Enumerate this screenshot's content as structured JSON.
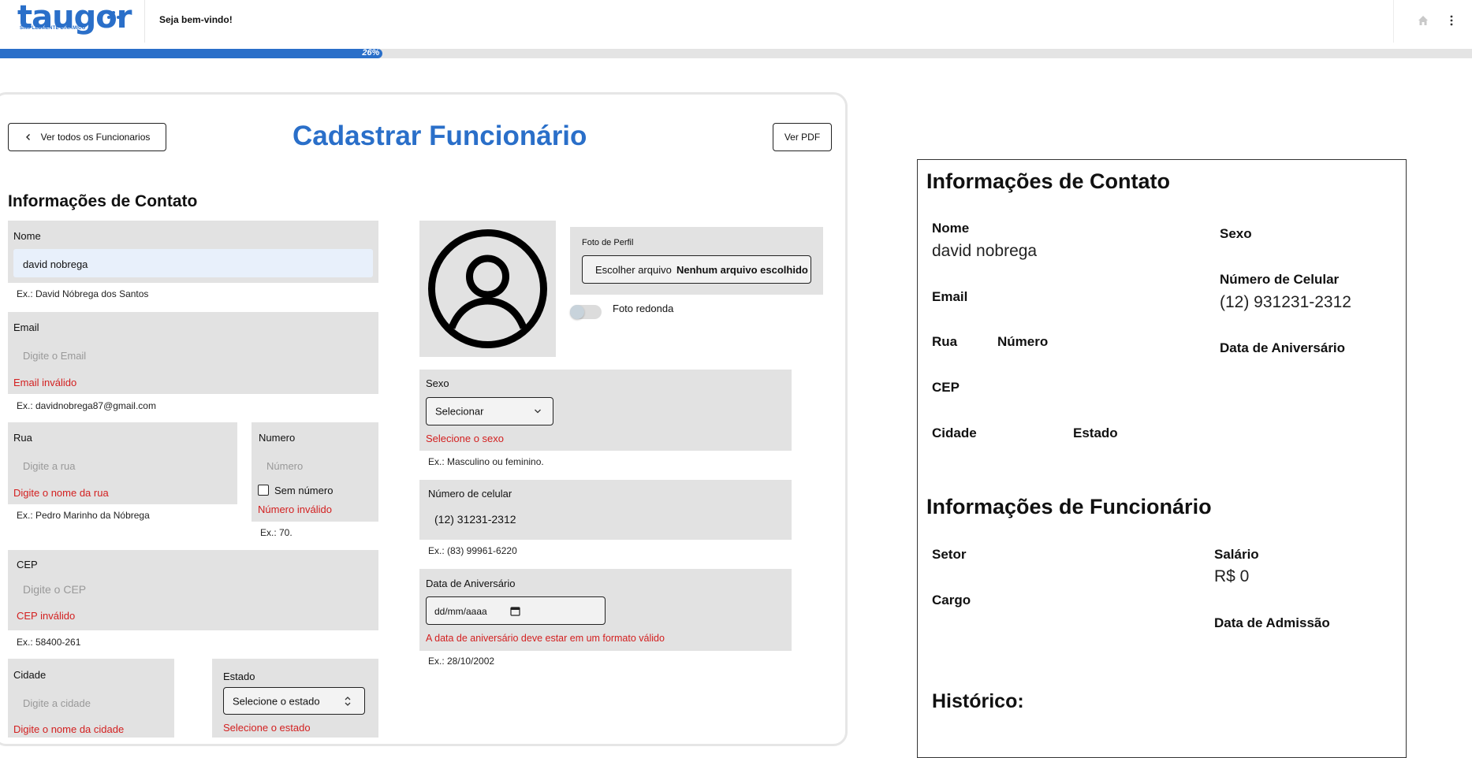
{
  "header": {
    "logo_text": "taugor",
    "logo_tagline": "SIMPLESMENTE DINÂMICO",
    "welcome": "Seja bem-vindo!",
    "home_icon": "home-icon",
    "menu_icon": "kebab-menu-icon"
  },
  "progress": {
    "value_percent": 26,
    "label": "26%"
  },
  "form": {
    "back_button": "Ver todos os Funcionarios",
    "title": "Cadastrar Funcionário",
    "pdf_button": "Ver PDF",
    "section_title": "Informações de Contato",
    "nome": {
      "label": "Nome",
      "value": "david nobrega",
      "hint": "Ex.: David Nóbrega dos Santos"
    },
    "email": {
      "label": "Email",
      "placeholder": "Digite o Email",
      "error": "Email inválido",
      "hint": "Ex.: davidnobrega87@gmail.com"
    },
    "rua": {
      "label": "Rua",
      "placeholder": "Digite a rua",
      "error": "Digite o nome da rua",
      "hint": "Ex.: Pedro Marinho da Nóbrega"
    },
    "numero": {
      "label": "Numero",
      "placeholder": "Número",
      "checkbox_label": "Sem número",
      "error": "Número inválido",
      "hint": "Ex.: 70."
    },
    "cep": {
      "label": "CEP",
      "placeholder": "Digite o CEP",
      "error": "CEP inválido",
      "hint": "Ex.: 58400-261"
    },
    "cidade": {
      "label": "Cidade",
      "placeholder": "Digite a cidade",
      "error": "Digite o nome da cidade"
    },
    "estado": {
      "label": "Estado",
      "selected": "Selecione o estado",
      "error": "Selecione o estado"
    },
    "foto": {
      "label": "Foto de Perfil",
      "button": "Escolher arquivo",
      "status": "Nenhum arquivo escolhido",
      "toggle_label": "Foto redonda",
      "toggle_on": false
    },
    "sexo": {
      "label": "Sexo",
      "selected": "Selecionar",
      "error": "Selecione o sexo",
      "hint": "Ex.: Masculino ou feminino."
    },
    "celular": {
      "label": "Número de celular",
      "value": "(12) 31231-2312",
      "hint": "Ex.: (83) 99961-6220"
    },
    "aniversario": {
      "label": "Data de Aniversário",
      "placeholder": "dd/mm/aaaa",
      "error": "A data de aniversário deve estar em um formato válido",
      "hint": "Ex.: 28/10/2002"
    }
  },
  "preview": {
    "contact_title": "Informações de Contato",
    "nome_label": "Nome",
    "nome_value": "david nobrega",
    "sexo_label": "Sexo",
    "celular_label": "Número de Celular",
    "celular_value": "(12) 931231-2312",
    "email_label": "Email",
    "rua_label": "Rua",
    "numero_label": "Número",
    "aniversario_label": "Data de Aniversário",
    "cep_label": "CEP",
    "cidade_label": "Cidade",
    "estado_label": "Estado",
    "employee_title": "Informações de Funcionário",
    "setor_label": "Setor",
    "salario_label": "Salário",
    "salario_value": "R$ 0",
    "cargo_label": "Cargo",
    "admissao_label": "Data de Admissão",
    "historico_title": "Histórico:"
  },
  "colors": {
    "brand": "#2a6fc9",
    "error": "#d32020",
    "field_bg": "#e2e2e2"
  }
}
